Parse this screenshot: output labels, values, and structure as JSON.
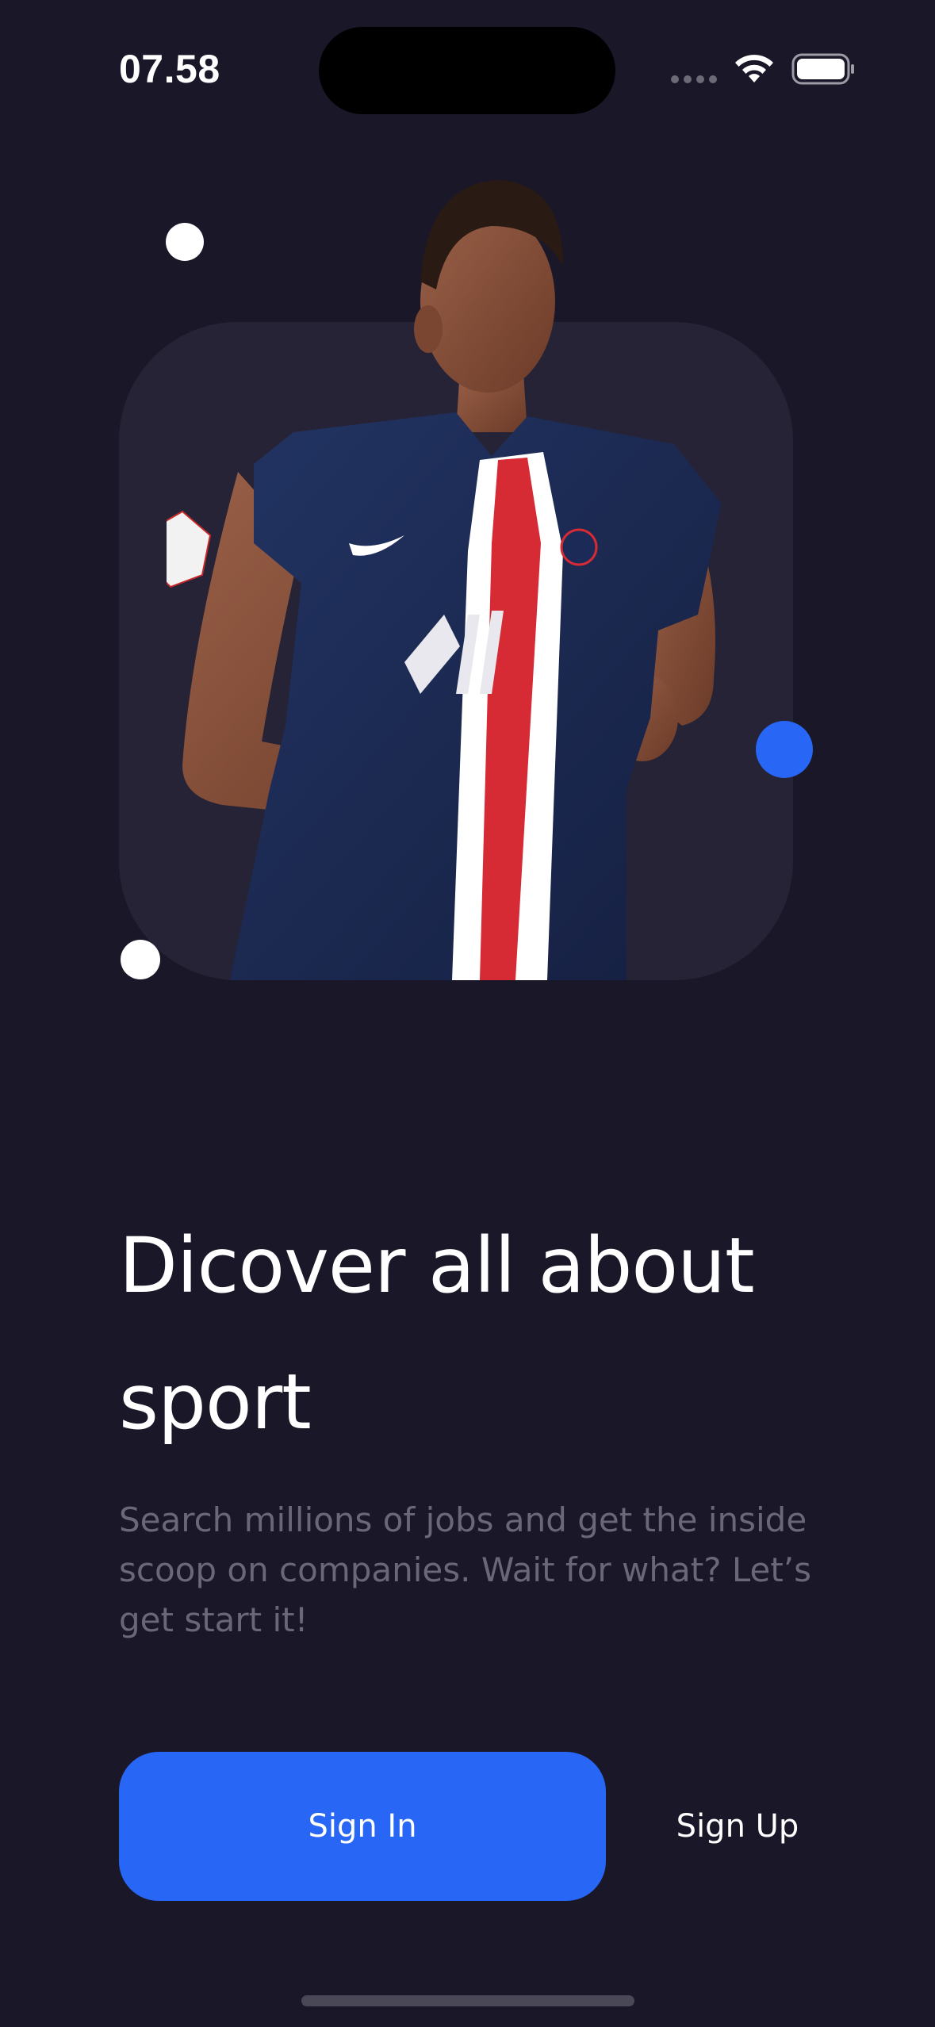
{
  "status_bar": {
    "time": "07.58",
    "icons": [
      "signal-dots-icon",
      "wifi-icon",
      "battery-icon"
    ]
  },
  "hero": {
    "image": "player-photo",
    "colors": {
      "card": "#252335",
      "accent": "#2866f6",
      "dot": "#ffffff"
    }
  },
  "headline": "Dicover all about sport",
  "subtitle": "Search millions of jobs and get the inside scoop on companies. Wait for what? Let’s get start it!",
  "actions": {
    "sign_in_label": "Sign In",
    "sign_up_label": "Sign Up"
  },
  "colors": {
    "background": "#1a1828",
    "primary": "#2866f6",
    "muted_text": "#6a6878"
  }
}
